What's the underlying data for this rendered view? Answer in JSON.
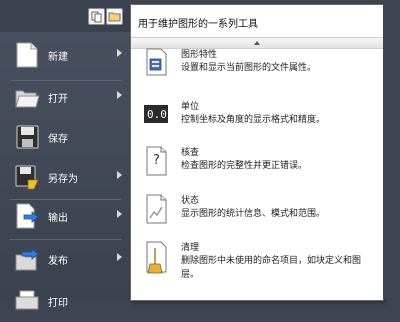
{
  "menu": {
    "items": [
      {
        "label": "新建",
        "has_submenu": true
      },
      {
        "label": "打开",
        "has_submenu": true
      },
      {
        "label": "保存",
        "has_submenu": false
      },
      {
        "label": "另存为",
        "has_submenu": true
      },
      {
        "label": "输出",
        "has_submenu": true
      },
      {
        "label": "发布",
        "has_submenu": true
      },
      {
        "label": "打印",
        "has_submenu": true
      }
    ]
  },
  "flyout": {
    "title": "用于维护图形的一系列工具",
    "items": [
      {
        "title": "图形特性",
        "desc": "设置和显示当前图形的文件属性。",
        "icon": "drawing-properties-icon"
      },
      {
        "title": "单位",
        "desc": "控制坐标及角度的显示格式和精度。",
        "icon": "units-icon",
        "icon_text": "0.0"
      },
      {
        "title": "核查",
        "desc": "检查图形的完整性并更正错误。",
        "icon": "audit-icon",
        "icon_text": "?"
      },
      {
        "title": "状态",
        "desc": "显示图形的统计信息、模式和范围。",
        "icon": "status-icon"
      },
      {
        "title": "清理",
        "desc": "删除图形中未使用的命名项目，如块定义和图层。",
        "icon": "purge-icon"
      }
    ]
  },
  "colors": {
    "panel_bg": "#3e4452",
    "flyout_bg": "#ffffff",
    "text_light": "#ffffff",
    "text_dark": "#222222"
  }
}
